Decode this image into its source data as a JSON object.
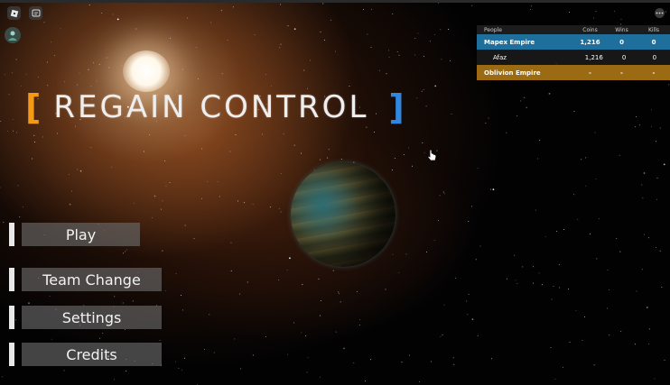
{
  "game": {
    "title": "REGAIN CONTROL",
    "bracket_left": "[",
    "bracket_right": "]"
  },
  "menu": {
    "items": [
      {
        "label": "Play"
      },
      {
        "label": "Team Change"
      },
      {
        "label": "Settings"
      },
      {
        "label": "Credits"
      }
    ]
  },
  "leaderboard": {
    "headers": [
      "People",
      "Coins",
      "Wins",
      "Kills"
    ],
    "rows": [
      {
        "type": "team",
        "name": "Mapex Empire",
        "coins": "1,216",
        "wins": "0",
        "kills": "0",
        "color": "#1f6f9c"
      },
      {
        "type": "player",
        "name": "Afaz",
        "coins": "1,216",
        "wins": "0",
        "kills": "0"
      },
      {
        "type": "team",
        "name": "Oblivion Empire",
        "coins": "-",
        "wins": "-",
        "kills": "-",
        "color": "#9a6b13"
      }
    ]
  },
  "icons": {
    "roblox_menu": "roblox-logo-icon",
    "chat": "chat-icon",
    "avatar": "player-avatar-icon",
    "more": "more-options-icon"
  },
  "colors": {
    "bracket_left": "#f59a16",
    "bracket_right": "#2f87e0",
    "team1": "#1f6f9c",
    "team2": "#9a6b13"
  }
}
